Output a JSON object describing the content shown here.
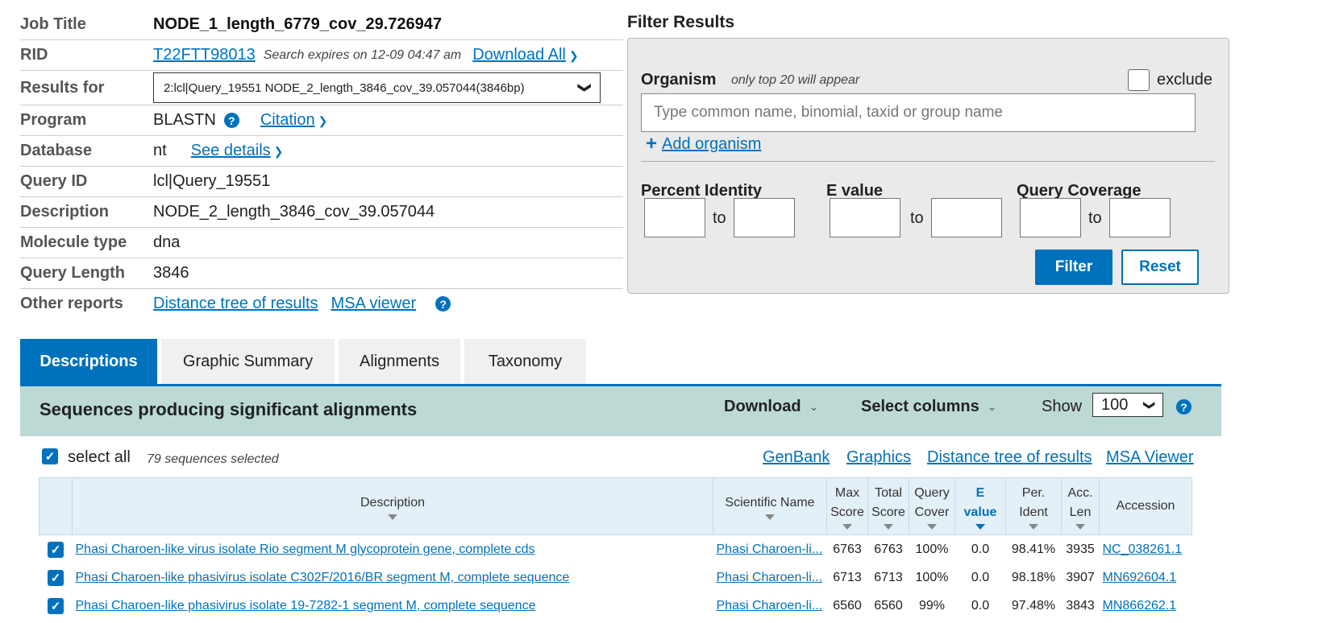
{
  "job": {
    "rows": [
      {
        "label": "Job Title",
        "value": "NODE_1_length_6779_cov_29.726947"
      },
      {
        "label": "RID",
        "value": "T22FTT98013"
      },
      {
        "label": "Results for",
        "value": "2:lcl|Query_19551 NODE_2_length_3846_cov_39.057044(3846bp)"
      },
      {
        "label": "Program",
        "value": "BLASTN"
      },
      {
        "label": "Database",
        "value": "nt"
      },
      {
        "label": "Query ID",
        "value": "lcl|Query_19551"
      },
      {
        "label": "Description",
        "value": "NODE_2_length_3846_cov_39.057044"
      },
      {
        "label": "Molecule type",
        "value": "dna"
      },
      {
        "label": "Query Length",
        "value": "3846"
      },
      {
        "label": "Other reports",
        "value": ""
      }
    ],
    "search_expires": "Search expires on 12-09 04:47 am",
    "download_all": "Download All",
    "citation": "Citation",
    "see_details": "See details",
    "distance_tree": "Distance tree of results",
    "msa_viewer": "MSA viewer"
  },
  "filter": {
    "title": "Filter Results",
    "organism_label": "Organism",
    "organism_hint": "only top 20 will appear",
    "exclude_label": "exclude",
    "organism_placeholder": "Type common  name, binomial, taxid or group  name",
    "add_organism": "Add organism",
    "percent_identity": "Percent Identity",
    "e_value": "E value",
    "query_coverage": "Query Coverage",
    "to": "to",
    "filter_button": "Filter",
    "reset_button": "Reset"
  },
  "tabs": [
    "Descriptions",
    "Graphic Summary",
    "Alignments",
    "Taxonomy"
  ],
  "results": {
    "title": "Sequences producing significant alignments",
    "download": "Download",
    "select_columns": "Select columns",
    "show_label": "Show",
    "show_value": "100",
    "select_all": "select all",
    "selected_count": "79 sequences selected",
    "links": [
      "GenBank",
      "Graphics",
      "Distance tree of results",
      "MSA Viewer"
    ],
    "columns": {
      "description": "Description",
      "scientific_name": "Scientific Name",
      "max_score_1": "Max",
      "max_score_2": "Score",
      "total_score_1": "Total",
      "total_score_2": "Score",
      "query_cover_1": "Query",
      "query_cover_2": "Cover",
      "e_value_1": "E",
      "e_value_2": "value",
      "per_ident_1": "Per.",
      "per_ident_2": "Ident",
      "acc_len_1": "Acc.",
      "acc_len_2": "Len",
      "accession": "Accession"
    },
    "rows": [
      {
        "description": "Phasi Charoen-like virus isolate Rio segment M glycoprotein gene, complete cds",
        "scientific_name": "Phasi Charoen-li...",
        "max_score": "6763",
        "total_score": "6763",
        "query_cover": "100%",
        "e_value": "0.0",
        "per_ident": "98.41%",
        "acc_len": "3935",
        "accession": "NC_038261.1"
      },
      {
        "description": "Phasi Charoen-like phasivirus isolate C302F/2016/BR segment M, complete sequence",
        "scientific_name": "Phasi Charoen-li...",
        "max_score": "6713",
        "total_score": "6713",
        "query_cover": "100%",
        "e_value": "0.0",
        "per_ident": "98.18%",
        "acc_len": "3907",
        "accession": "MN692604.1"
      },
      {
        "description": "Phasi Charoen-like phasivirus isolate 19-7282-1 segment M, complete sequence",
        "scientific_name": "Phasi Charoen-li...",
        "max_score": "6560",
        "total_score": "6560",
        "query_cover": "99%",
        "e_value": "0.0",
        "per_ident": "97.48%",
        "acc_len": "3843",
        "accession": "MN866262.1"
      }
    ]
  }
}
